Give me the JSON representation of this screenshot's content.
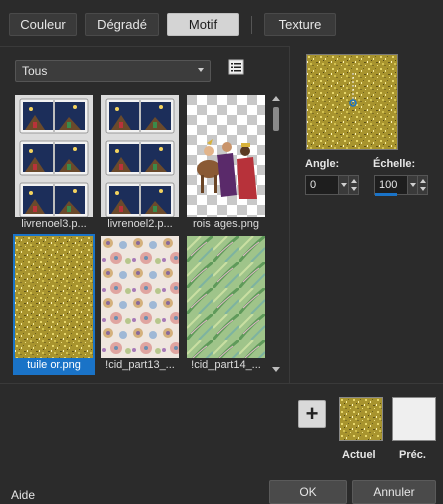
{
  "tabs": {
    "color": "Couleur",
    "gradient": "Dégradé",
    "pattern": "Motif",
    "texture": "Texture",
    "active": "pattern"
  },
  "filter": {
    "selected": "Tous",
    "list_view_icon": "list-view-icon"
  },
  "patterns": [
    {
      "caption": "livrenoel3.p...",
      "kind": "nativity-book"
    },
    {
      "caption": "livrenoel2.p...",
      "kind": "nativity-book"
    },
    {
      "caption": "rois ages.png",
      "kind": "magi-transparent"
    },
    {
      "caption": "tuile or.png",
      "kind": "gold-glitter",
      "selected": true
    },
    {
      "caption": "!cid_part13_...",
      "kind": "circles-pastel"
    },
    {
      "caption": "!cid_part14_...",
      "kind": "green-feathers"
    }
  ],
  "angle": {
    "label": "Angle:",
    "value": "0"
  },
  "scale": {
    "label": "Échelle:",
    "value": "100"
  },
  "swatches": {
    "current_label": "Actuel",
    "previous_label": "Préc.",
    "add_icon": "plus-icon"
  },
  "footer": {
    "help": "Aide",
    "ok": "OK",
    "cancel": "Annuler"
  },
  "colors": {
    "accent": "#1a73c7",
    "background": "#2b2b2b",
    "gold": "#b9a53a"
  }
}
